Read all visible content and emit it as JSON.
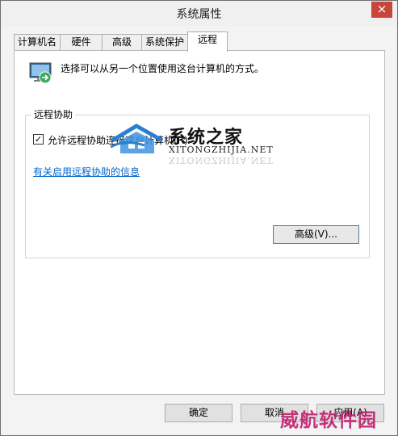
{
  "window": {
    "title": "系统属性",
    "close_glyph": "×"
  },
  "tabs": [
    {
      "label": "计算机名"
    },
    {
      "label": "硬件"
    },
    {
      "label": "高级"
    },
    {
      "label": "系统保护"
    },
    {
      "label": "远程",
      "active": true
    }
  ],
  "panel": {
    "intro_text": "选择可以从另一个位置使用这台计算机的方式。",
    "intro_icon": "remote-computer-icon",
    "remote_assistance": {
      "group_label": "远程协助",
      "checkbox_label": "允许远程协助连接这台计算机(R)",
      "checkbox_checked": true,
      "checkbox_glyph": "✓",
      "link_text": "有关启用远程协助的信息",
      "advanced_button": "高级(V)..."
    }
  },
  "footer": {
    "ok": "确定",
    "cancel": "取消",
    "apply": "应用(A)"
  },
  "watermarks": {
    "brand_title": "系统之家",
    "brand_sub": "XITONGZHIJIA.NET",
    "corner": "威航软件园"
  },
  "colors": {
    "link": "#0066cc",
    "close": "#c7453a",
    "accent_border": "#3c7fb1",
    "corner_watermark": "#c2186b"
  }
}
